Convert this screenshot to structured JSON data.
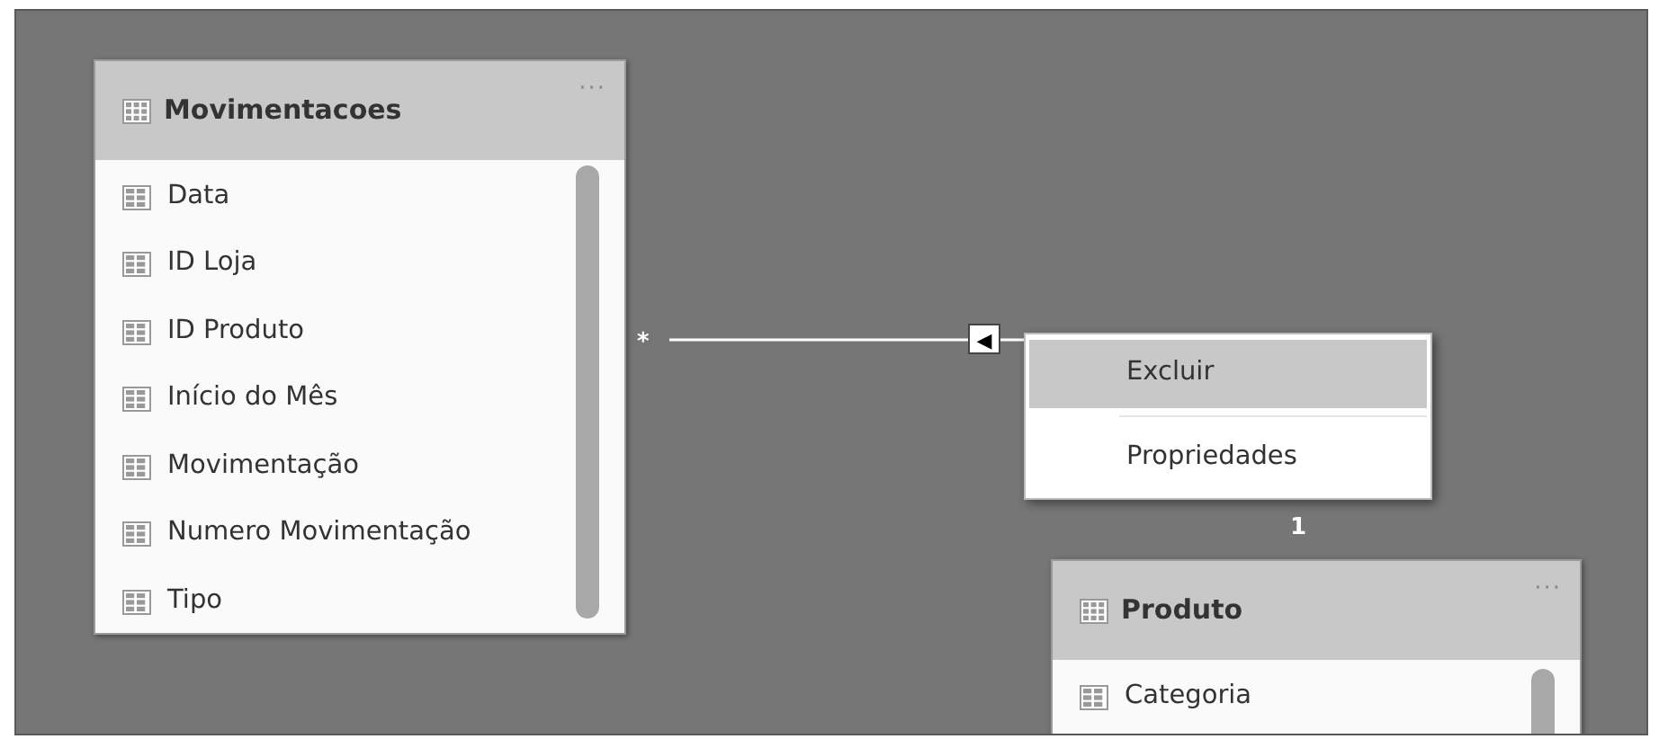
{
  "tables": [
    {
      "name": "Movimentacoes",
      "more": "···",
      "columns": [
        "Data",
        "ID Loja",
        "ID Produto",
        "Início do Mês",
        "Movimentação",
        "Numero Movimentação",
        "Tipo"
      ]
    },
    {
      "name": "Produto",
      "more": "···",
      "columns": [
        "Categoria"
      ]
    }
  ],
  "relationship": {
    "from_label": "*",
    "to_label": "1",
    "arrow": "◀"
  },
  "context_menu": {
    "items": [
      {
        "label": "Excluir",
        "selected": true
      },
      {
        "label": "Propriedades",
        "selected": false
      }
    ]
  }
}
